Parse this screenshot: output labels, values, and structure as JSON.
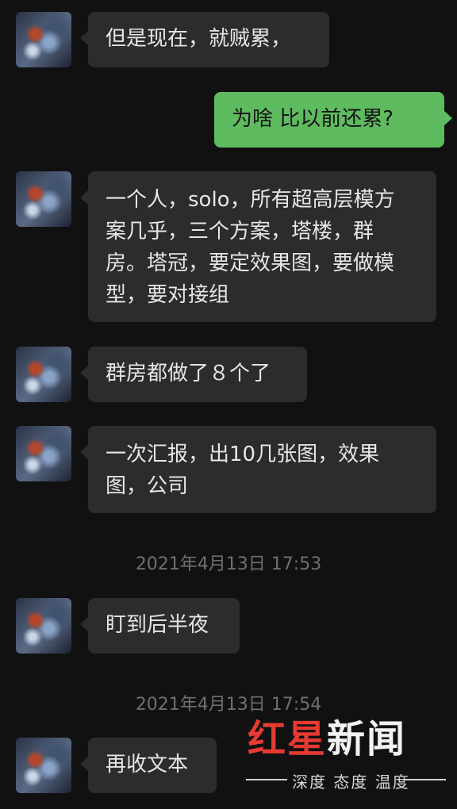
{
  "messages": [
    {
      "side": "left",
      "text": "但是现在，就贼累，"
    },
    {
      "side": "right",
      "text": "为啥  比以前还累?"
    },
    {
      "side": "left",
      "lines": [
        "一个人，solo，所有超高层模方",
        "案几乎，三个方案，塔楼，群",
        "房。塔冠，要定效果图，要做模",
        "型，要对接组"
      ]
    },
    {
      "side": "left",
      "text": "群房都做了８个了"
    },
    {
      "side": "left",
      "lines": [
        "一次汇报，出10几张图，效果",
        "图，公司"
      ]
    },
    {
      "side": "left",
      "text": "盯到后半夜"
    },
    {
      "side": "left",
      "text": "再收文本"
    }
  ],
  "timestamps": [
    "2021年4月13日 17:53",
    "2021年4月13日 17:54"
  ],
  "watermark": {
    "title_part1": "红星",
    "title_part2": "新闻",
    "subtitle": "深度 态度 温度"
  },
  "colors": {
    "background": "#111111",
    "bubble_other": "#2c2c2c",
    "bubble_mine": "#5ebb5f",
    "watermark_red": "#e63a32"
  }
}
